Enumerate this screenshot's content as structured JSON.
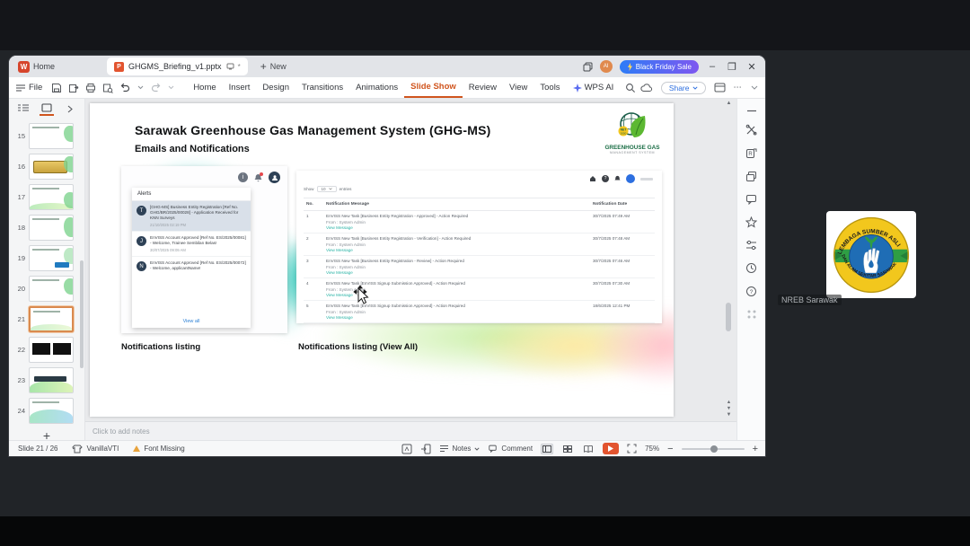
{
  "colors": {
    "accent_orange": "#d0551e",
    "promo_from": "#2e7cf6",
    "promo_to": "#7e57f0",
    "link_teal": "#2ab3a6",
    "brand_red": "#d6452c"
  },
  "tabbar": {
    "home_label": "Home",
    "doc_title": "GHGMS_Briefing_v1.pptx",
    "new_label": "New",
    "promo": "Black Friday Sale"
  },
  "toolbar": {
    "file_label": "File",
    "menu": [
      "Home",
      "Insert",
      "Design",
      "Transitions",
      "Animations",
      "Slide Show",
      "Review",
      "View",
      "Tools"
    ],
    "ai_label": "WPS AI",
    "share_label": "Share"
  },
  "slide_panel": {
    "slides": [
      "15",
      "16",
      "17",
      "18",
      "19",
      "20",
      "21",
      "22",
      "23",
      "24"
    ],
    "selected": "21",
    "add_label": "+"
  },
  "slide": {
    "title": "Sarawak Greenhouse Gas Management System (GHG-MS)",
    "subtitle": "Emails and Notifications",
    "logo_line1": "GREENHOUSE GAS",
    "logo_line2": "MANAGEMENT SYSTEM",
    "logo_badge": "NET",
    "left_caption": "Notifications listing",
    "right_caption": "Notifications listing (View All)",
    "alerts": {
      "header": "Alerts",
      "view_all": "View all",
      "items": [
        {
          "avatar": "T",
          "text": "[GHG-MS] Business Entity Registration [Ref No. GHG/BR/2025/00028] - Application Received for KNN Surveys",
          "time": "21/10/2025 02:19 PM"
        },
        {
          "avatar": "J",
          "text": "EnVISS Account Approved [Ref No. ES/2025/00081] - Welcome, Trainee Sembilan Belas!",
          "time": "30/07/2025 09:09 AM"
        },
        {
          "avatar": "N",
          "text": "EnVISS Account Approved [Ref No. ES/2025/00072] - Welcome, applicantName!",
          "time": ""
        }
      ]
    },
    "table": {
      "show_label": "Show",
      "show_value": "10",
      "entries_label": "entries",
      "columns": {
        "no": "No.",
        "message": "Notification Message",
        "date": "Notification Date"
      },
      "rows": [
        {
          "no": "1",
          "message": "EnVISS New Task [Business Entity Registration - Approved] - Action Required",
          "from": "From : System Admin",
          "link": "View Message",
          "date": "30/7/2025 07:49 AM"
        },
        {
          "no": "2",
          "message": "EnVISS New Task [Business Entity Registration - Verification] - Action Required",
          "from": "From : System Admin",
          "link": "View Message",
          "date": "30/7/2025 07:48 AM"
        },
        {
          "no": "3",
          "message": "EnVISS New Task [Business Entity Registration - Review] - Action Required",
          "from": "From : System Admin",
          "link": "View Message",
          "date": "30/7/2025 07:46 AM"
        },
        {
          "no": "4",
          "message": "EnVISS New Task [EnVISS Signup Submission Approved] - Action Required",
          "from": "From : System Admin",
          "link": "View Message",
          "date": "30/7/2025 07:30 AM"
        },
        {
          "no": "5",
          "message": "EnVISS New Task [EnVISS Signup Submission Approved] - Action Required",
          "from": "From : System Admin",
          "link": "View Message",
          "date": "18/6/2025 12:41 PM"
        }
      ]
    }
  },
  "notes": {
    "placeholder": "Click to add notes"
  },
  "statusbar": {
    "slide_counter": "Slide 21 / 26",
    "theme": "VanillaVTI",
    "font_missing": "Font Missing",
    "notes_label": "Notes",
    "comment_label": "Comment",
    "zoom": "75%"
  },
  "meeting": {
    "participant_label": "NREB Sarawak",
    "logo_top_text": "LEMBAGA SUMBER ASLI",
    "logo_bottom_text": "DAN ALAM SEKITAR SARAWAK"
  }
}
